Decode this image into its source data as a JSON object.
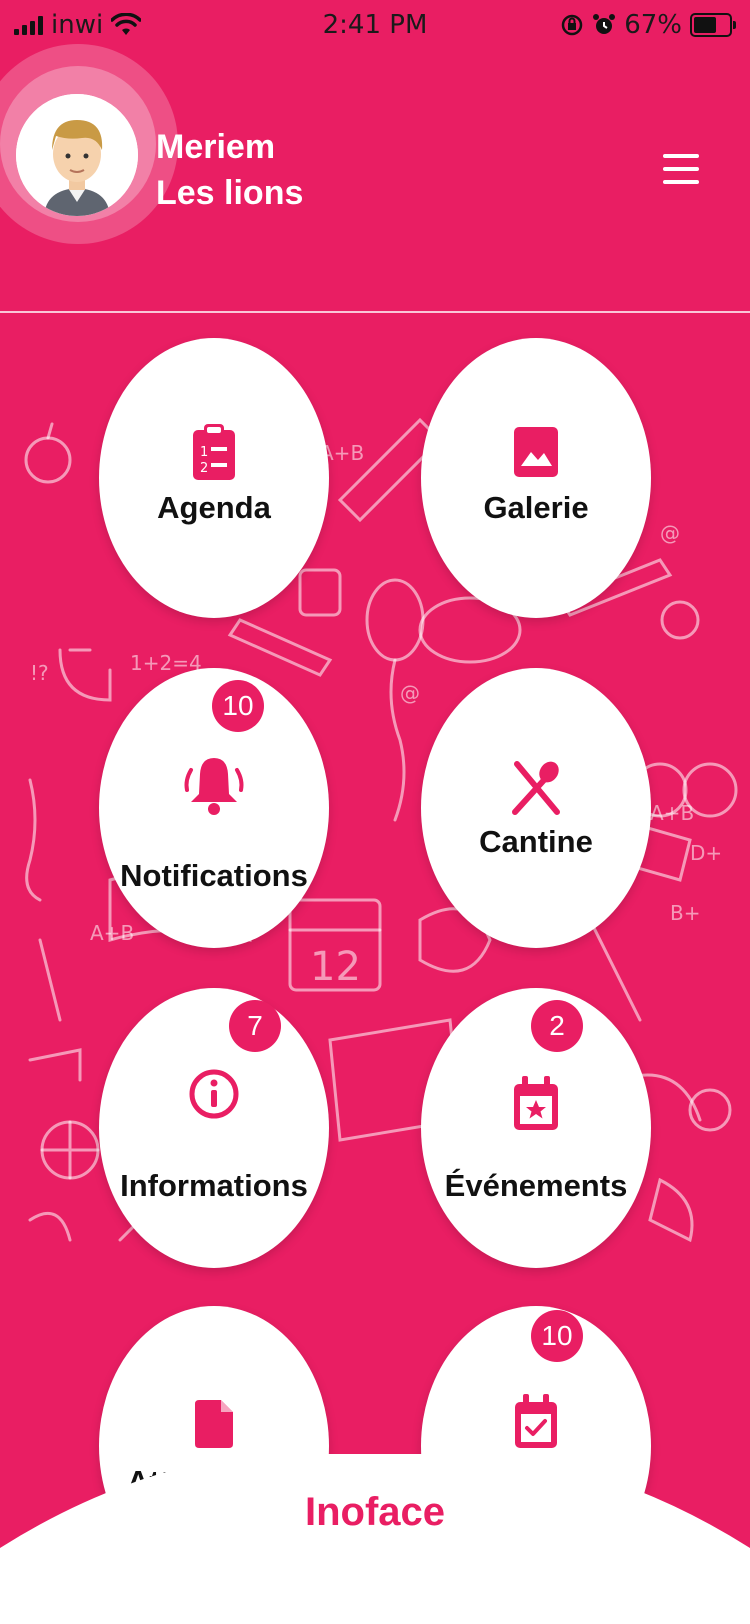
{
  "status_bar": {
    "carrier": "inwi",
    "time": "2:41 PM",
    "battery": "67%"
  },
  "header": {
    "first_name": "Meriem",
    "class_name": "Les lions",
    "menu_icon": "hamburger-menu-icon",
    "avatar": "boy-avatar"
  },
  "tiles": [
    {
      "label": "Agenda",
      "icon": "clipboard-list-icon"
    },
    {
      "label": "Galerie",
      "icon": "image-icon"
    },
    {
      "label": "Notifications",
      "icon": "bell-icon",
      "badge": "10"
    },
    {
      "label": "Cantine",
      "icon": "fork-spoon-icon"
    },
    {
      "label": "Informations",
      "icon": "info-icon",
      "badge": "7"
    },
    {
      "label": "Événements",
      "icon": "calendar-star-icon",
      "badge": "2"
    },
    {
      "label": "Att",
      "icon": "document-icon"
    },
    {
      "label": "",
      "icon": "calendar-check-icon",
      "badge": "10"
    }
  ],
  "footer": {
    "brand": "Inoface"
  },
  "colors": {
    "accent": "#e91e63",
    "tile": "#ffffff"
  }
}
